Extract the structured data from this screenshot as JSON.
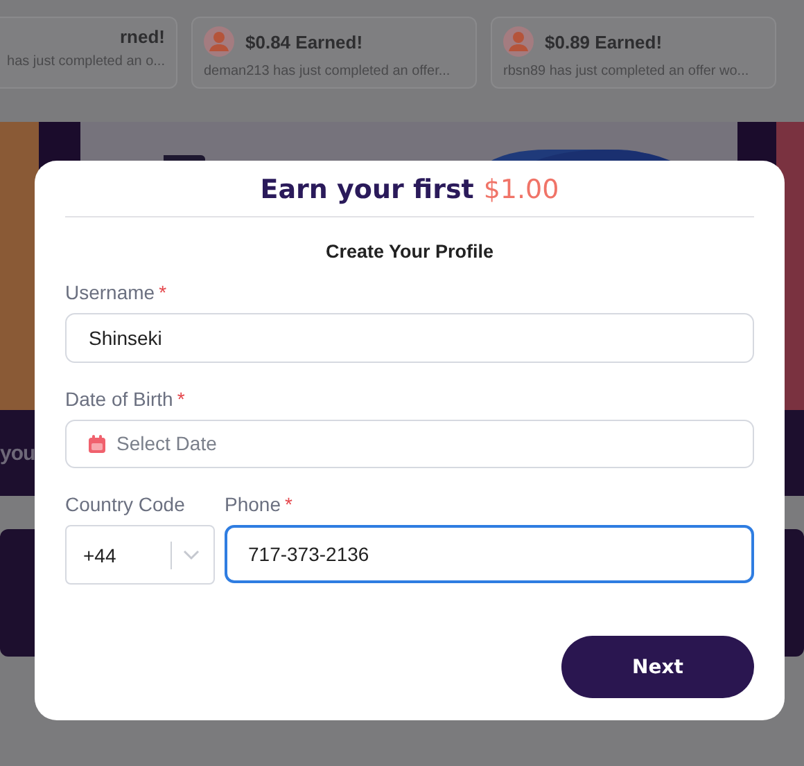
{
  "activity_feed": [
    {
      "title": "rned!",
      "message": "has just completed an o...",
      "show_avatar": false
    },
    {
      "title": "$0.84 Earned!",
      "message": "deman213 has just completed an offer...",
      "show_avatar": true
    },
    {
      "title": "$0.89 Earned!",
      "message": "rbsn89 has just completed an offer wo...",
      "show_avatar": true
    }
  ],
  "banner": {
    "side_text": "you"
  },
  "modal": {
    "title": "Earn your first",
    "title_amount": "$1.00",
    "subtitle": "Create Your Profile",
    "fields": [
      {
        "kind": "text",
        "label": "Username",
        "required_mark": "*",
        "value": "Shinseki",
        "focused": false
      },
      {
        "kind": "date",
        "label": "Date of Birth",
        "required_mark": "*",
        "placeholder": "Select Date",
        "focused": false
      }
    ],
    "country_code": {
      "label": "Country Code",
      "value": "+44"
    },
    "phone": {
      "label": "Phone",
      "required_mark": "*",
      "value": "717-373-2136",
      "focused": true
    },
    "next_button": "Next"
  }
}
